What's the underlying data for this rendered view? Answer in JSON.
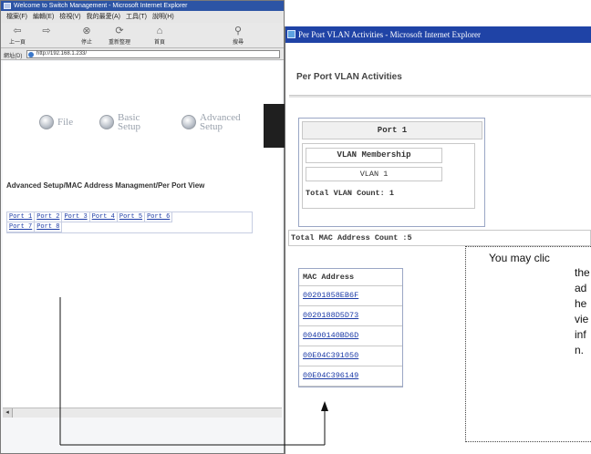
{
  "back_window": {
    "title": "Welcome to Switch Management - Microsoft Internet Explorer",
    "menu": [
      "檔案(F)",
      "編輯(E)",
      "檢視(V)",
      "我的最愛(A)",
      "工具(T)",
      "說明(H)"
    ],
    "toolbar": {
      "back": "上一頁",
      "stop": "停止",
      "refresh": "重新整理",
      "home": "首頁",
      "search": "搜尋"
    },
    "address_label": "網址(D)",
    "address_value": "http://192.168.1.233/",
    "nav": {
      "file": "File",
      "basic_setup_1": "Basic",
      "basic_setup_2": "Setup",
      "advanced_setup_1": "Advanced",
      "advanced_setup_2": "Setup"
    },
    "breadcrumb": "Advanced Setup/MAC Address Managment/Per Port View",
    "ports": [
      [
        "Port 1",
        "Port 2",
        "Port 3",
        "Port 4",
        "Port 5",
        "Port 6"
      ],
      [
        "Port 7",
        "Port 8"
      ]
    ]
  },
  "front_window": {
    "title": "Per Port VLAN Activities - Microsoft Internet Explorer",
    "heading": "Per Port VLAN Activities",
    "port_title": "Port 1",
    "vlan_membership_label": "VLAN Membership",
    "vlan_item": "VLAN 1",
    "total_vlan_count": "Total VLAN Count: 1",
    "total_mac_count": "Total MAC Address Count :5",
    "mac_header": "MAC Address",
    "mac_addresses": [
      "00201858EB6F",
      "0020188D5D73",
      "00400140BD6D",
      "00E04C391050",
      "00E04C396149"
    ]
  },
  "callout": {
    "lines": [
      "You may clic",
      "the",
      "ad",
      "he",
      "vie",
      "inf",
      "n."
    ]
  },
  "colors": {
    "titlebar": "#1f43a6",
    "link": "#1b3aa6",
    "panel_border": "#9aa6c5"
  }
}
